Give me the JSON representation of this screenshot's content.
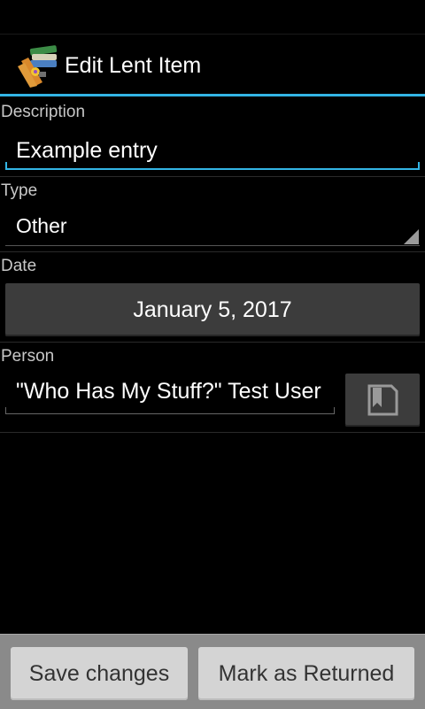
{
  "action_bar": {
    "title": "Edit Lent Item",
    "app_icon": "books-stack-icon"
  },
  "form": {
    "description": {
      "label": "Description",
      "value": "Example entry"
    },
    "type": {
      "label": "Type",
      "selected": "Other"
    },
    "date": {
      "label": "Date",
      "value": "January 5, 2017"
    },
    "person": {
      "label": "Person",
      "value": "\"Who Has My Stuff?\" Test User",
      "picker_icon": "contact-book-icon"
    }
  },
  "buttons": {
    "save": "Save changes",
    "mark_returned": "Mark as Returned"
  },
  "colors": {
    "accent": "#33b5e5",
    "background": "#000000",
    "button_dark": "#3c3c3c",
    "button_light": "#d4d4d4"
  }
}
